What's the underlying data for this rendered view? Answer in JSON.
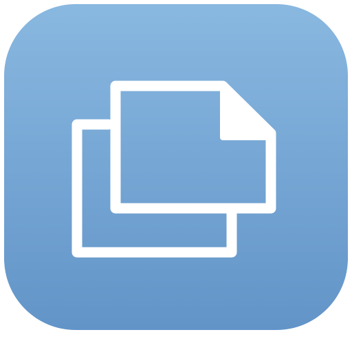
{
  "app_icon": {
    "icon": "duplicate-documents-icon",
    "colors": {
      "gradient_top": "#89b8e0",
      "gradient_bottom": "#6294c8",
      "glyph": "#ffffff"
    }
  }
}
